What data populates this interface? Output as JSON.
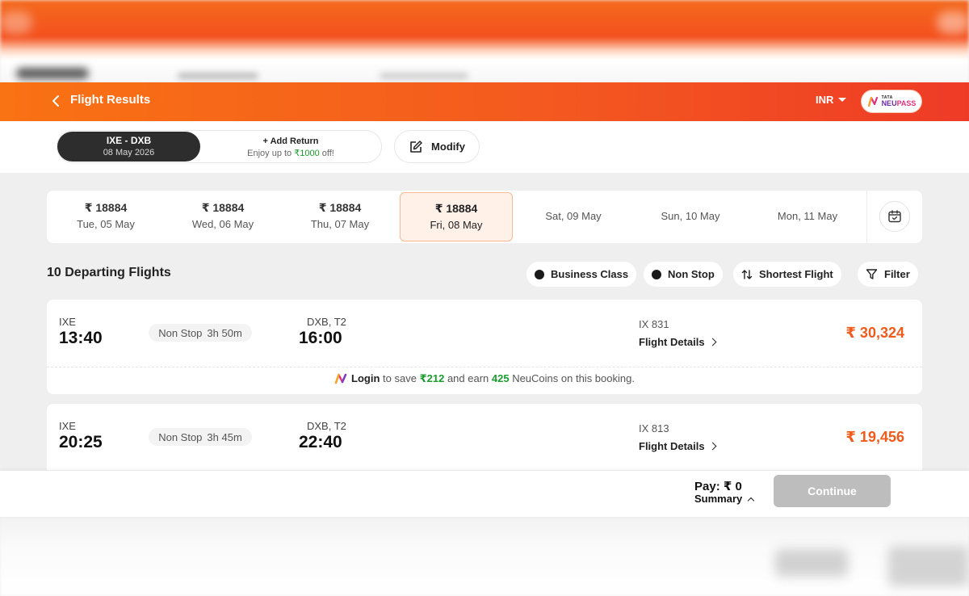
{
  "header": {
    "title": "Flight Results",
    "currency": "INR",
    "neupass": {
      "brand_top": "TATA",
      "brand_neu": "NEU",
      "brand_pass": "PASS"
    }
  },
  "search": {
    "route": "IXE - DXB",
    "date": "08 May 2026",
    "add_return_title": "+ Add Return",
    "add_return_sub_prefix": "Enjoy up to ",
    "add_return_amount": "₹1000",
    "add_return_sub_suffix": " off!",
    "modify_label": "Modify"
  },
  "dates": [
    {
      "price": "₹ 18884",
      "label": "Tue, 05 May"
    },
    {
      "price": "₹ 18884",
      "label": "Wed, 06 May"
    },
    {
      "price": "₹ 18884",
      "label": "Thu, 07 May"
    },
    {
      "price": "₹ 18884",
      "label": "Fri, 08 May",
      "active": true
    },
    {
      "price": "",
      "label": "Sat, 09 May"
    },
    {
      "price": "",
      "label": "Sun, 10 May"
    },
    {
      "price": "",
      "label": "Mon, 11 May"
    }
  ],
  "results": {
    "count_title": "10 Departing Flights",
    "chips": {
      "business": "Business Class",
      "nonstop": "Non Stop",
      "shortest": "Shortest Flight",
      "filter": "Filter"
    }
  },
  "flights": [
    {
      "dep_code": "IXE",
      "dep_time": "13:40",
      "stop": "Non Stop",
      "duration": "3h 50m",
      "arr_code": "DXB, T2",
      "arr_time": "16:00",
      "flight_no": "IX 831",
      "details": "Flight Details",
      "price": "₹ 30,324",
      "promo": {
        "login": "Login",
        "to_save": " to save ",
        "save_amt": "₹212",
        "and_earn": " and earn ",
        "coins": "425",
        "suffix": " NeuCoins on this booking."
      }
    },
    {
      "dep_code": "IXE",
      "dep_time": "20:25",
      "stop": "Non Stop",
      "duration": "3h 45m",
      "arr_code": "DXB, T2",
      "arr_time": "22:40",
      "flight_no": "IX 813",
      "details": "Flight Details",
      "price": "₹ 19,456"
    }
  ],
  "footer": {
    "pay": "Pay: ₹ 0",
    "summary": "Summary",
    "continue": "Continue"
  },
  "colors": {
    "accent": "#f45a1f",
    "price": "#f05a1a",
    "green": "#1a9d2d",
    "disabled": "#bdbdbd"
  }
}
